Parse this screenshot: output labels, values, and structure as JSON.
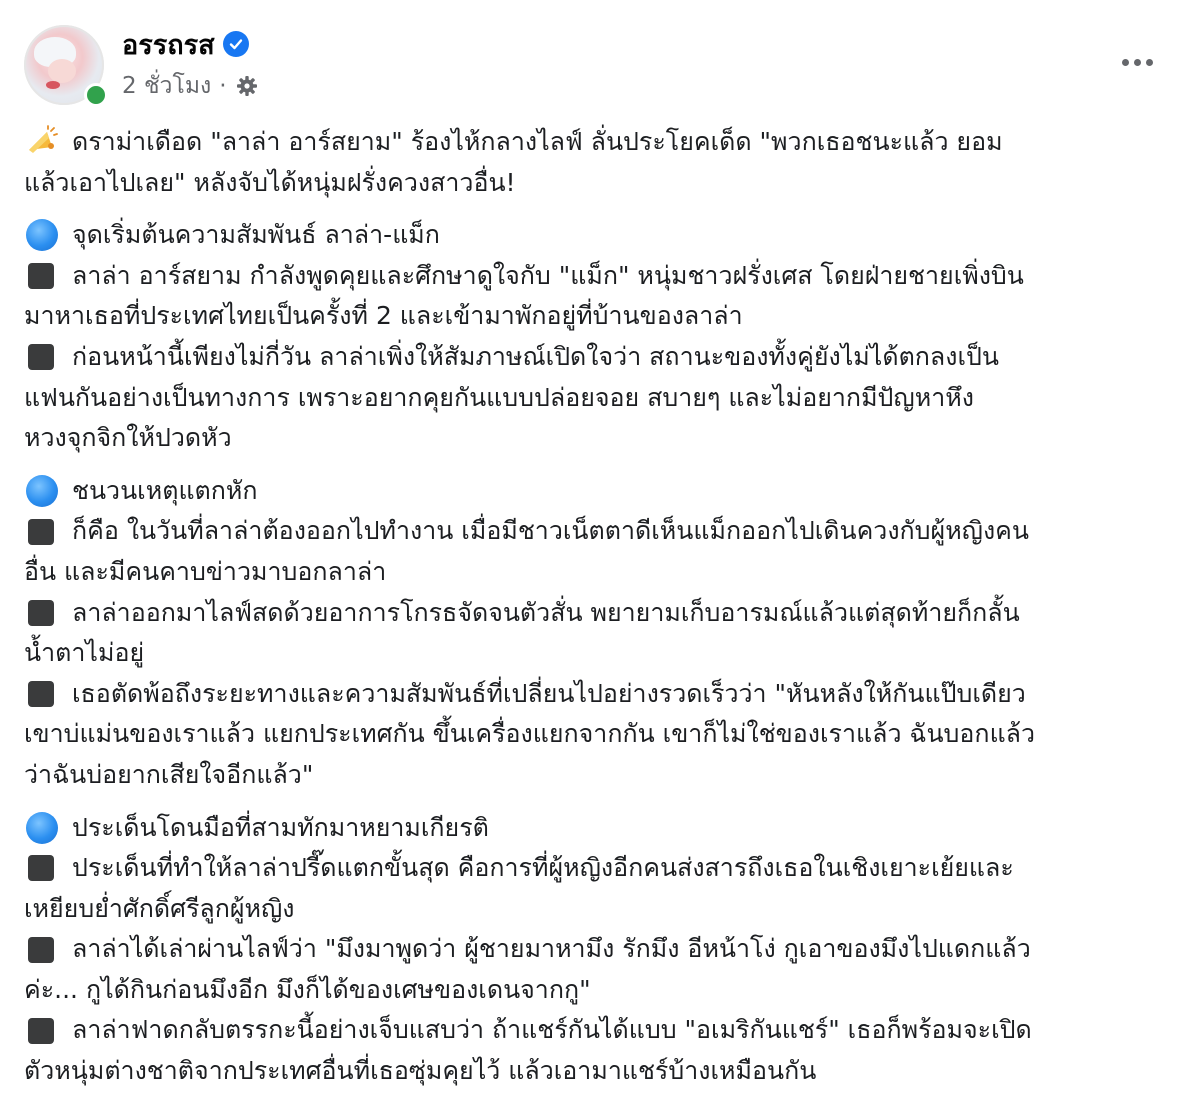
{
  "post": {
    "author": "อรรถรส",
    "time": "2 ชั่วโมง",
    "separator": "·",
    "lines": [
      {
        "icon": "megaphone-icon",
        "text": "ดราม่าเดือด \"ลาล่า อาร์สยาม\" ร้องไห้กลางไลฟ์ ลั่นประโยคเด็ด \"พวกเธอชนะแล้ว ยอม"
      },
      {
        "icon": "",
        "text": "แล้วเอาไปเลย\" หลังจับได้หนุ่มฝรั่งควงสาวอื่น!"
      },
      {
        "gap": true
      },
      {
        "icon": "blue-circle-icon",
        "text": "จุดเริ่มต้นความสัมพันธ์ ลาล่า-แม็ก"
      },
      {
        "icon": "black-square-icon",
        "text": "ลาล่า อาร์สยาม กำลังพูดคุยและศึกษาดูใจกับ \"แม็ก\" หนุ่มชาวฝรั่งเศส โดยฝ่ายชายเพิ่งบิน"
      },
      {
        "icon": "",
        "text": "มาหาเธอที่ประเทศไทยเป็นครั้งที่ 2 และเข้ามาพักอยู่ที่บ้านของลาล่า"
      },
      {
        "icon": "black-square-icon",
        "text": "ก่อนหน้านี้เพียงไม่กี่วัน ลาล่าเพิ่งให้สัมภาษณ์เปิดใจว่า สถานะของทั้งคู่ยังไม่ได้ตกลงเป็น"
      },
      {
        "icon": "",
        "text": "แฟนกันอย่างเป็นทางการ เพราะอยากคุยกันแบบปล่อยจอย สบายๆ และไม่อยากมีปัญหาหึง"
      },
      {
        "icon": "",
        "text": "หวงจุกจิกให้ปวดหัว"
      },
      {
        "gap": true
      },
      {
        "icon": "blue-circle-icon",
        "text": "ชนวนเหตุแตกหัก"
      },
      {
        "icon": "black-square-icon",
        "text": "ก็คือ ในวันที่ลาล่าต้องออกไปทำงาน เมื่อมีชาวเน็ตตาดีเห็นแม็กออกไปเดินควงกับผู้หญิงคน"
      },
      {
        "icon": "",
        "text": "อื่น และมีคนคาบข่าวมาบอกลาล่า"
      },
      {
        "icon": "black-square-icon",
        "text": "ลาล่าออกมาไลฟ์สดด้วยอาการโกรธจัดจนตัวสั่น พยายามเก็บอารมณ์แล้วแต่สุดท้ายก็กลั้น"
      },
      {
        "icon": "",
        "text": "น้ำตาไม่อยู่"
      },
      {
        "icon": "black-square-icon",
        "text": "เธอตัดพ้อถึงระยะทางและความสัมพันธ์ที่เปลี่ยนไปอย่างรวดเร็วว่า \"หันหลังให้กันแป๊บเดียว"
      },
      {
        "icon": "",
        "text": "เขาบ่แม่นของเราแล้ว แยกประเทศกัน ขึ้นเครื่องแยกจากกัน เขาก็ไม่ใช่ของเราแล้ว ฉันบอกแล้ว"
      },
      {
        "icon": "",
        "text": "ว่าฉันบ่อยากเสียใจอีกแล้ว\""
      },
      {
        "gap": true
      },
      {
        "icon": "blue-circle-icon",
        "text": "ประเด็นโดนมือที่สามทักมาหยามเกียรติ"
      },
      {
        "icon": "black-square-icon",
        "text": "ประเด็นที่ทำให้ลาล่าปรี๊ดแตกขั้นสุด คือการที่ผู้หญิงอีกคนส่งสารถึงเธอในเชิงเยาะเย้ยและ"
      },
      {
        "icon": "",
        "text": "เหยียบย่ำศักดิ์ศรีลูกผู้หญิง"
      },
      {
        "icon": "black-square-icon",
        "text": "ลาล่าได้เล่าผ่านไลฟ์ว่า \"มึงมาพูดว่า ผู้ชายมาหามึง รักมึง อีหน้าโง่ กูเอาของมึงไปแดกแล้ว"
      },
      {
        "icon": "",
        "text": "ค่ะ... กูได้กินก่อนมึงอีก มึงก็ได้ของเศษของเดนจากกู\""
      },
      {
        "icon": "black-square-icon",
        "text": "ลาล่าฟาดกลับตรรกะนี้อย่างเจ็บแสบว่า ถ้าแชร์กันได้แบบ \"อเมริกันแชร์\" เธอก็พร้อมจะเปิด"
      },
      {
        "icon": "",
        "text": "ตัวหนุ่มต่างชาติจากประเทศอื่นที่เธอซุ่มคุยไว้ แล้วเอามาแชร์บ้างเหมือนกัน"
      }
    ]
  }
}
